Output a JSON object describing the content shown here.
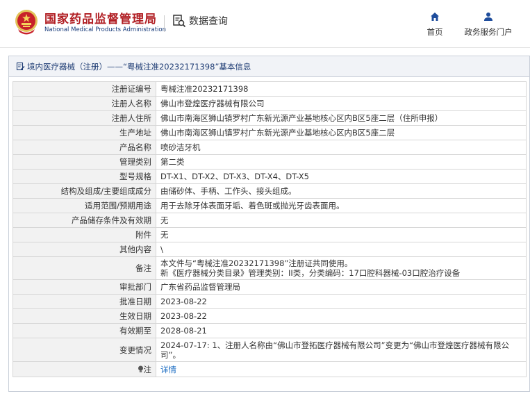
{
  "header": {
    "org_cn": "国家药品监督管理局",
    "org_en": "National Medical Products Administration",
    "query_label": "数据查询",
    "query_icon": "search-document-icon",
    "nav": [
      {
        "label": "首页",
        "icon": "home-icon"
      },
      {
        "label": "政务服务门户",
        "icon": "user-icon"
      }
    ]
  },
  "panel": {
    "title": "境内医疗器械（注册）——“粤械注准20232171398”基本信息"
  },
  "rows": [
    {
      "key": "注册证编号",
      "value": "粤械注准20232171398"
    },
    {
      "key": "注册人名称",
      "value": "佛山市登煌医疗器械有限公司"
    },
    {
      "key": "注册人住所",
      "value": "佛山市南海区狮山镇罗村广东新光源产业基地核心区内B区5座二层（住所申报）"
    },
    {
      "key": "生产地址",
      "value": "佛山市南海区狮山镇罗村广东新光源产业基地核心区内B区5座二层"
    },
    {
      "key": "产品名称",
      "value": "喷砂洁牙机"
    },
    {
      "key": "管理类别",
      "value": "第二类"
    },
    {
      "key": "型号规格",
      "value": "DT-X1、DT-X2、DT-X3、DT-X4、DT-X5"
    },
    {
      "key": "结构及组成/主要组成成分",
      "value": "由储砂体、手柄、工作头、接头组成。"
    },
    {
      "key": "适用范围/预期用途",
      "value": "用于去除牙体表面牙垢、着色斑或抛光牙齿表面用。"
    },
    {
      "key": "产品储存条件及有效期",
      "value": "无"
    },
    {
      "key": "附件",
      "value": "无"
    },
    {
      "key": "其他内容",
      "value": "\\"
    },
    {
      "key": "备注",
      "value_line1": "本文件与“粤械注准20232171398”注册证共同使用。",
      "value_line2": "新《医疗器械分类目录》管理类别：II类，分类编码：17口腔科器械-03口腔治疗设备"
    },
    {
      "key": "审批部门",
      "value": "广东省药品监督管理局"
    },
    {
      "key": "批准日期",
      "value": "2023-08-22"
    },
    {
      "key": "生效日期",
      "value": "2023-08-22"
    },
    {
      "key": "有效期至",
      "value": "2028-08-21"
    },
    {
      "key": "变更情况",
      "value": "2024-07-17: 1、注册人名称由“佛山市登拓医疗器械有限公司”变更为“佛山市登煌医疗器械有限公司”。"
    },
    {
      "key": "注",
      "key_icon": "lightbulb-icon",
      "value": "详情"
    }
  ],
  "colors": {
    "brand_red": "#b11f24",
    "navy": "#1e3c74",
    "link": "#1b6cc2"
  }
}
